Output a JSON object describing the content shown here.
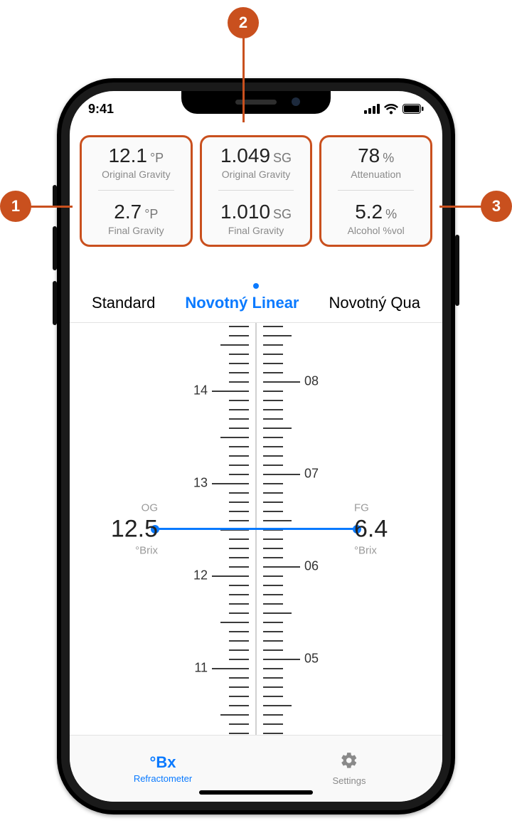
{
  "annotations": {
    "b1": "1",
    "b2": "2",
    "b3": "3"
  },
  "status": {
    "time": "9:41"
  },
  "cards": [
    {
      "top_value": "12.1",
      "top_unit": "°P",
      "top_label": "Original Gravity",
      "bot_value": "2.7",
      "bot_unit": "°P",
      "bot_label": "Final Gravity"
    },
    {
      "top_value": "1.049",
      "top_unit": "SG",
      "top_label": "Original Gravity",
      "bot_value": "1.010",
      "bot_unit": "SG",
      "bot_label": "Final Gravity"
    },
    {
      "top_value": "78",
      "top_unit": "%",
      "top_label": "Attenuation",
      "bot_value": "5.2",
      "bot_unit": "%",
      "bot_label": "Alcohol %vol"
    }
  ],
  "modes": {
    "items": [
      "Standard",
      "Novotný Linear",
      "Novotný Qua"
    ],
    "active_index": 1
  },
  "ruler": {
    "left": {
      "visible_labels": [
        "14",
        "13",
        "12",
        "11"
      ],
      "tag": "OG",
      "value": "12.5",
      "unit": "°Brix"
    },
    "right": {
      "visible_labels": [
        "08",
        "07",
        "06",
        "05"
      ],
      "tag": "FG",
      "value": "6.4",
      "unit": "°Brix"
    }
  },
  "tabbar": {
    "items": [
      {
        "icon": "°Bx",
        "label": "Refractometer",
        "active": true
      },
      {
        "icon": "gear",
        "label": "Settings",
        "active": false
      }
    ]
  }
}
